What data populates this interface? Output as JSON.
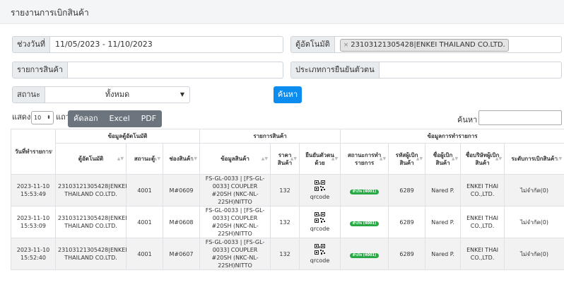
{
  "page": {
    "title": "รายงานการเบิกสินค้า"
  },
  "filters": {
    "date_label": "ช่วงวันที่",
    "date_value": "11/05/2023 - 11/10/2023",
    "locker_label": "ตู้อัตโนมัติ",
    "locker_tag_remove": "×",
    "locker_tag": "23103121305428|ENKEI THAILAND CO.LTD.",
    "item_label": "รายการสินค้า",
    "item_value": "",
    "confirm_type_label": "ประเภทการยืนยันตัวตน",
    "confirm_type_value": "",
    "status_label": "สถานะ",
    "status_value": "ทั้งหมด",
    "status_caret": "▼"
  },
  "search_button": "ค้นหา",
  "table_controls": {
    "show_label": "แสดง",
    "length_value": "10",
    "length_arrows": "⬍",
    "rows_label_partial": "แถว",
    "export_buttons": [
      "คัดลอก",
      "Excel",
      "PDF"
    ],
    "search_label": "ค้นหา :",
    "search_value": ""
  },
  "table": {
    "group_headers": {
      "machine_info": "ข้อมูลตู้อัตโนมัติ",
      "item_list": "รายการสินค้า",
      "transaction_info": "ข้อมูลการทำรายการ"
    },
    "columns": [
      "วันที่ทำรายการ",
      "ตู้อัตโนมัติ",
      "สถานะตู้",
      "ช่องสินค้า",
      "ข้อมูลสินค้า",
      "ราคาสินค้า",
      "ยืนยันตัวตนด้วย",
      "สถานะการทำรายการ",
      "รหัสผู้เบิกสินค้า",
      "ชื่อผู้เบิกสินค้า",
      "ชื่อบริษัทผู้เบิกสินค้า",
      "ระดับการเบิกสินค้า"
    ],
    "sort_arrows": "▲▼",
    "rows": [
      {
        "date": "2023-11-10 15:53:49",
        "machine": "23103121305428|ENKEI THAILAND CO.LTD.",
        "machine_status": "4001",
        "slot": "M#0609",
        "item": "FS-GL-0033 | [FS-GL-0033] COUPLER #20SH (NKC-NL-22SH)NITTO",
        "price": "132",
        "confirm_by": "qrcode",
        "status_badge": "สำเร็จ (4001)",
        "user_code": "6289",
        "user_name": "Nared P.",
        "company": "ENKEI THAI CO.,LTD.",
        "level": "ไม่จำกัด(0)"
      },
      {
        "date": "2023-11-10 15:53:09",
        "machine": "23103121305428|ENKEI THAILAND CO.LTD.",
        "machine_status": "4001",
        "slot": "M#0608",
        "item": "FS-GL-0033 | [FS-GL-0033] COUPLER #20SH (NKC-NL-22SH)NITTO",
        "price": "132",
        "confirm_by": "qrcode",
        "status_badge": "สำเร็จ (4001)",
        "user_code": "6289",
        "user_name": "Nared P.",
        "company": "ENKEI THAI CO.,LTD.",
        "level": "ไม่จำกัด(0)"
      },
      {
        "date": "2023-11-10 15:52:40",
        "machine": "23103121305428|ENKEI THAILAND CO.LTD.",
        "machine_status": "4001",
        "slot": "M#0607",
        "item": "FS-GL-0033 | [FS-GL-0033] COUPLER #20SH (NKC-NL-22SH)NITTO",
        "price": "132",
        "confirm_by": "qrcode",
        "status_badge": "สำเร็จ (4001)",
        "user_code": "6289",
        "user_name": "Nared P.",
        "company": "ENKEI THAI CO.,LTD.",
        "level": "ไม่จำกัด(0)"
      }
    ]
  },
  "colors": {
    "primary": "#0d8cf0",
    "export_bg": "#6c757d",
    "success": "#28a745"
  },
  "icons": {
    "qr": "qrcode-icon",
    "sort": "sort-icon",
    "remove": "close-icon",
    "caret": "chevron-down-icon"
  }
}
